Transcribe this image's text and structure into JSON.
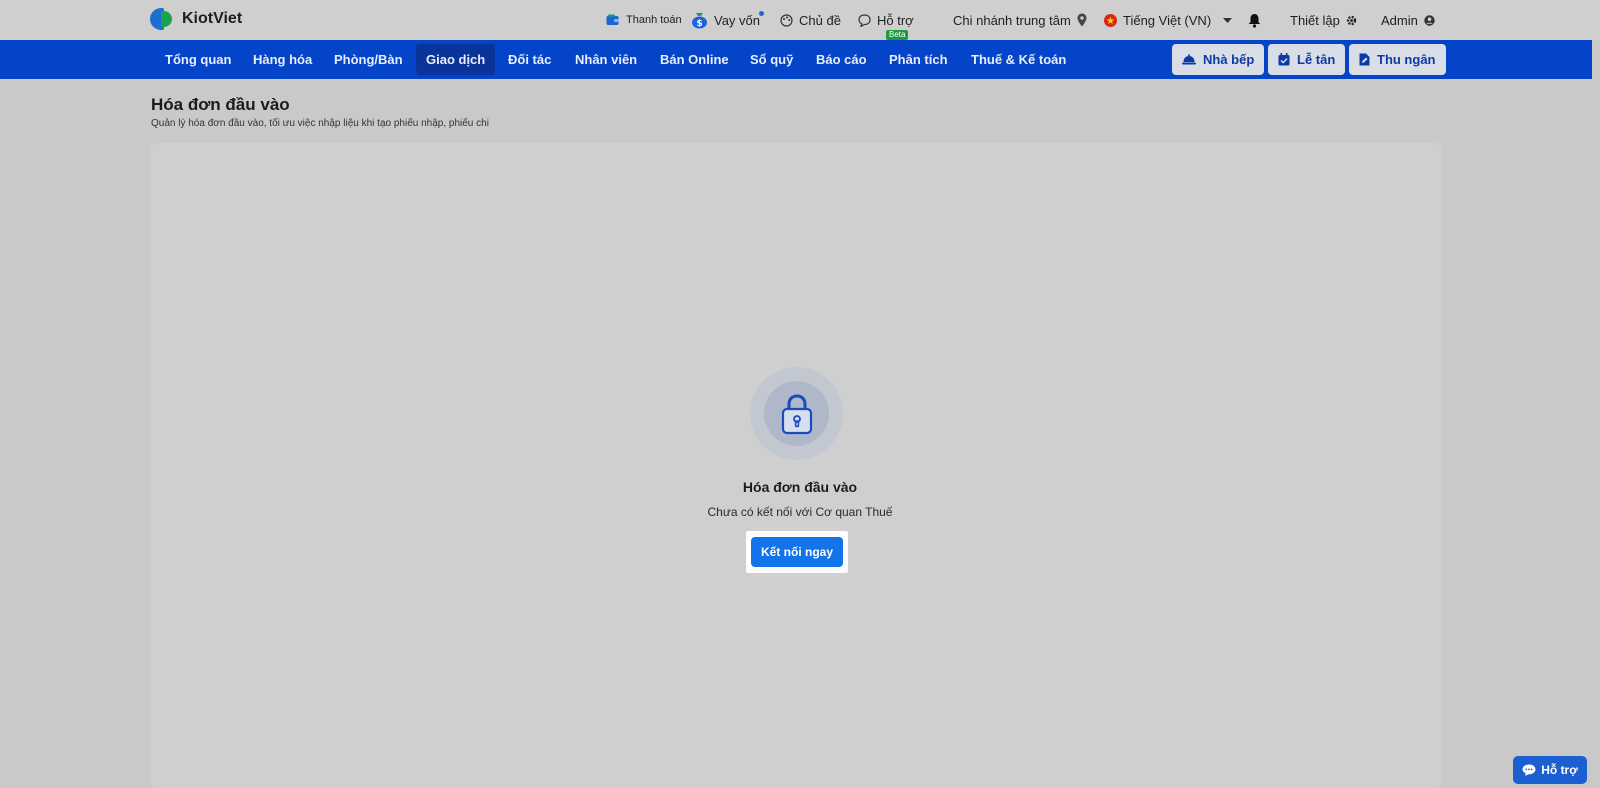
{
  "brand": {
    "name": "KiotViet"
  },
  "topbar": {
    "payment": "Thanh toán",
    "loan": "Vay vốn",
    "theme": "Chủ đề",
    "support": "Hỗ trợ",
    "beta_badge": "Beta",
    "branch": "Chi nhánh trung tâm",
    "language": "Tiếng Việt (VN)",
    "settings": "Thiết lập",
    "user": "Admin"
  },
  "nav": {
    "items": [
      {
        "label": "Tổng quan"
      },
      {
        "label": "Hàng hóa"
      },
      {
        "label": "Phòng/Bàn"
      },
      {
        "label": "Giao dịch",
        "active": true
      },
      {
        "label": "Đối tác"
      },
      {
        "label": "Nhân viên"
      },
      {
        "label": "Bán Online"
      },
      {
        "label": "Sổ quỹ"
      },
      {
        "label": "Báo cáo"
      },
      {
        "label": "Phân tích"
      },
      {
        "label": "Thuế & Kế toán"
      }
    ],
    "kitchen_button": "Nhà bếp",
    "reception_button": "Lễ tân",
    "cashier_button": "Thu ngân"
  },
  "page": {
    "title": "Hóa đơn đầu vào",
    "subtitle": "Quản lý hóa đơn đầu vào, tối ưu việc nhập liệu khi tạo phiếu nhập, phiếu chi"
  },
  "empty_state": {
    "title": "Hóa đơn đầu vào",
    "message": "Chưa có kết nối với Cơ quan Thuế",
    "connect_button": "Kết nối ngay",
    "icon": "lock-icon"
  },
  "help_fab": {
    "label": "Hỗ trợ"
  },
  "colors": {
    "nav_bg": "#0344c8",
    "primary_button": "#1273eb",
    "nav_active": "#0a349a"
  }
}
